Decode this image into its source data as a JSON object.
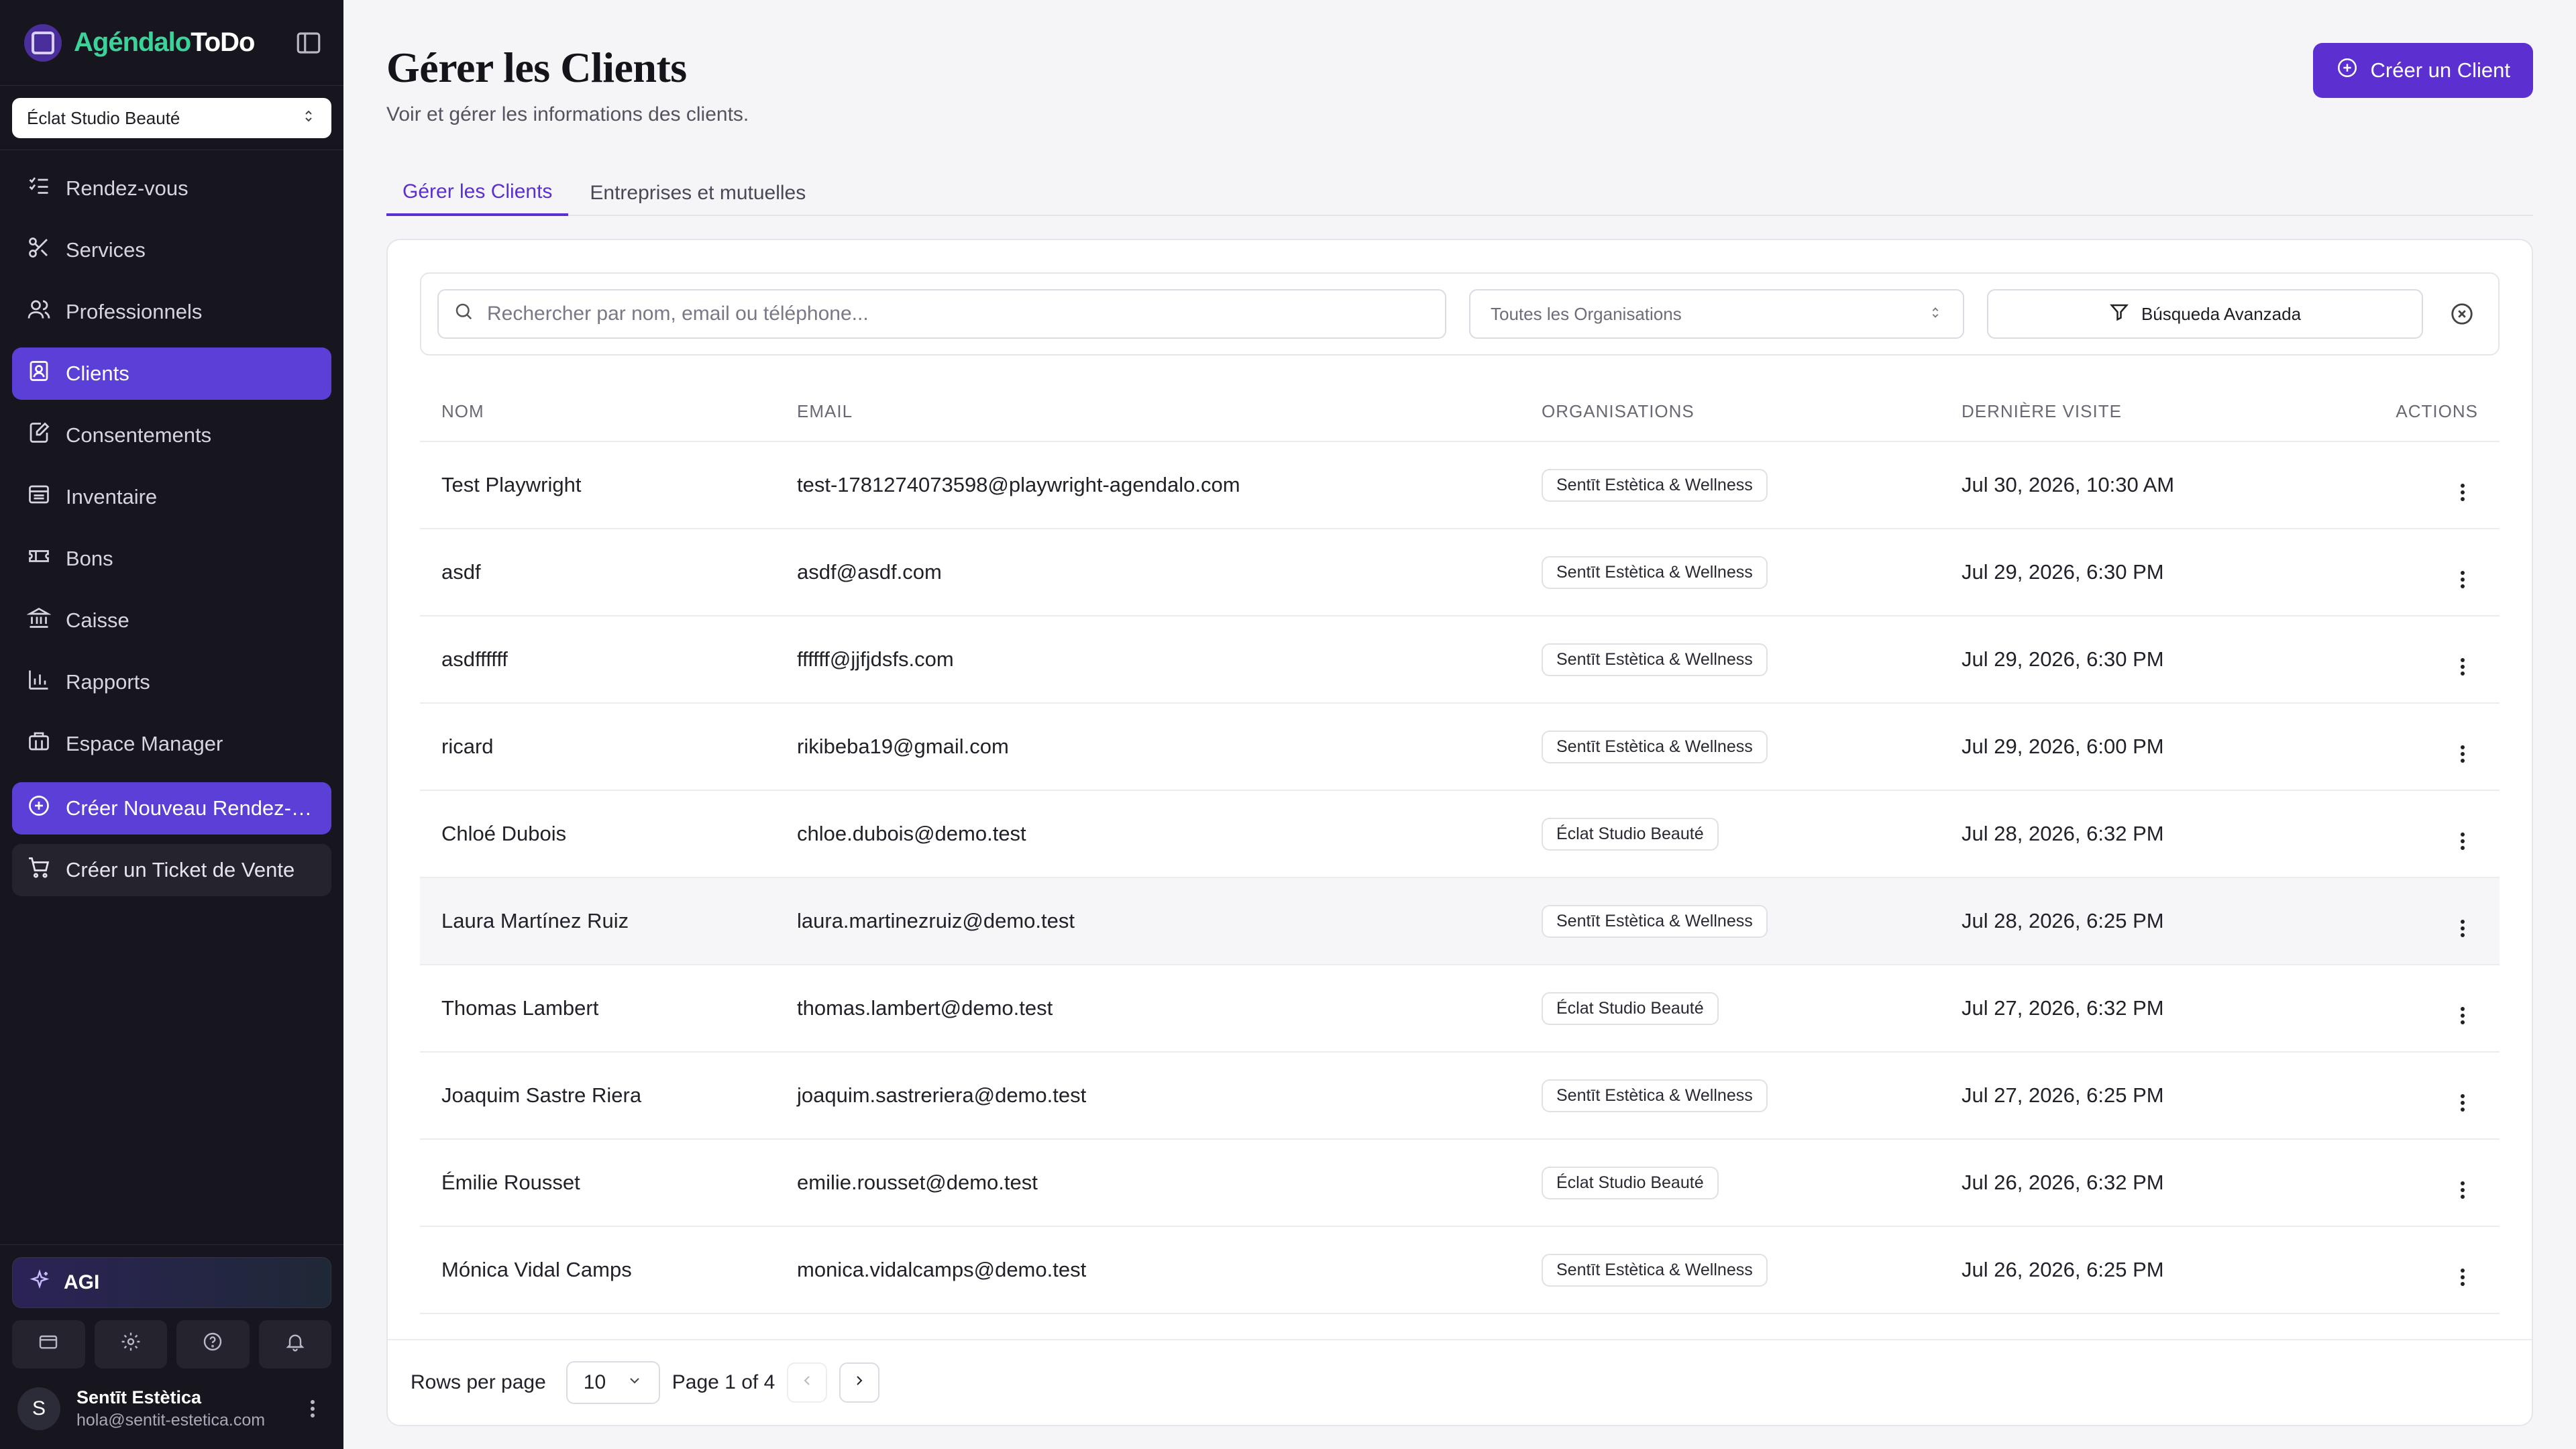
{
  "brand": {
    "name_part1": "Agéndalo",
    "name_part2": "ToDo"
  },
  "org_selector": {
    "value": "Éclat Studio Beauté"
  },
  "nav": [
    {
      "label": "Rendez-vous",
      "icon": "list-check-icon"
    },
    {
      "label": "Services",
      "icon": "scissors-icon"
    },
    {
      "label": "Professionnels",
      "icon": "users-icon"
    },
    {
      "label": "Clients",
      "icon": "contact-icon"
    },
    {
      "label": "Consentements",
      "icon": "file-signature-icon"
    },
    {
      "label": "Inventaire",
      "icon": "box-icon"
    },
    {
      "label": "Bons",
      "icon": "ticket-icon"
    },
    {
      "label": "Caisse",
      "icon": "bank-icon"
    },
    {
      "label": "Rapports",
      "icon": "chart-icon"
    },
    {
      "label": "Espace Manager",
      "icon": "building-icon"
    }
  ],
  "nav_actions": {
    "new_appointment": "Créer Nouveau Rendez-vous",
    "new_ticket": "Créer un Ticket de Vente"
  },
  "agi": {
    "label": "AGI"
  },
  "user": {
    "initial": "S",
    "name": "Sentīt Estètica",
    "email": "hola@sentit-estetica.com"
  },
  "page": {
    "title": "Gérer les Clients",
    "subtitle": "Voir et gérer les informations des clients.",
    "create_button": "Créer un Client"
  },
  "tabs": [
    "Gérer les Clients",
    "Entreprises et mutuelles"
  ],
  "filters": {
    "search_placeholder": "Rechercher par nom, email ou téléphone...",
    "org_filter": "Toutes les Organisations",
    "advanced": "Búsqueda Avanzada"
  },
  "table": {
    "columns": [
      "NOM",
      "EMAIL",
      "ORGANISATIONS",
      "DERNIÈRE VISITE",
      "ACTIONS"
    ],
    "rows": [
      {
        "name": "Test Playwright",
        "email": "test-1781274073598@playwright-agendalo.com",
        "org": "Sentīt Estètica & Wellness",
        "last_visit": "Jul 30, 2026, 10:30 AM"
      },
      {
        "name": "asdf",
        "email": "asdf@asdf.com",
        "org": "Sentīt Estètica & Wellness",
        "last_visit": "Jul 29, 2026, 6:30 PM"
      },
      {
        "name": "asdffffff",
        "email": "ffffff@jjfjdsfs.com",
        "org": "Sentīt Estètica & Wellness",
        "last_visit": "Jul 29, 2026, 6:30 PM"
      },
      {
        "name": "ricard",
        "email": "rikibeba19@gmail.com",
        "org": "Sentīt Estètica & Wellness",
        "last_visit": "Jul 29, 2026, 6:00 PM"
      },
      {
        "name": "Chloé Dubois",
        "email": "chloe.dubois@demo.test",
        "org": "Éclat Studio Beauté",
        "last_visit": "Jul 28, 2026, 6:32 PM"
      },
      {
        "name": "Laura Martínez Ruiz",
        "email": "laura.martinezruiz@demo.test",
        "org": "Sentīt Estètica & Wellness",
        "last_visit": "Jul 28, 2026, 6:25 PM"
      },
      {
        "name": "Thomas Lambert",
        "email": "thomas.lambert@demo.test",
        "org": "Éclat Studio Beauté",
        "last_visit": "Jul 27, 2026, 6:32 PM"
      },
      {
        "name": "Joaquim Sastre Riera",
        "email": "joaquim.sastreriera@demo.test",
        "org": "Sentīt Estètica & Wellness",
        "last_visit": "Jul 27, 2026, 6:25 PM"
      },
      {
        "name": "Émilie Rousset",
        "email": "emilie.rousset@demo.test",
        "org": "Éclat Studio Beauté",
        "last_visit": "Jul 26, 2026, 6:32 PM"
      },
      {
        "name": "Mónica Vidal Camps",
        "email": "monica.vidalcamps@demo.test",
        "org": "Sentīt Estètica & Wellness",
        "last_visit": "Jul 26, 2026, 6:25 PM"
      }
    ]
  },
  "pagination": {
    "rows_label": "Rows per page",
    "rows_value": "10",
    "page_label": "Page 1 of 4"
  },
  "colors": {
    "accent": "#5b2fd0",
    "sidebar_bg": "#17161f",
    "brand_green": "#3bd39a"
  }
}
